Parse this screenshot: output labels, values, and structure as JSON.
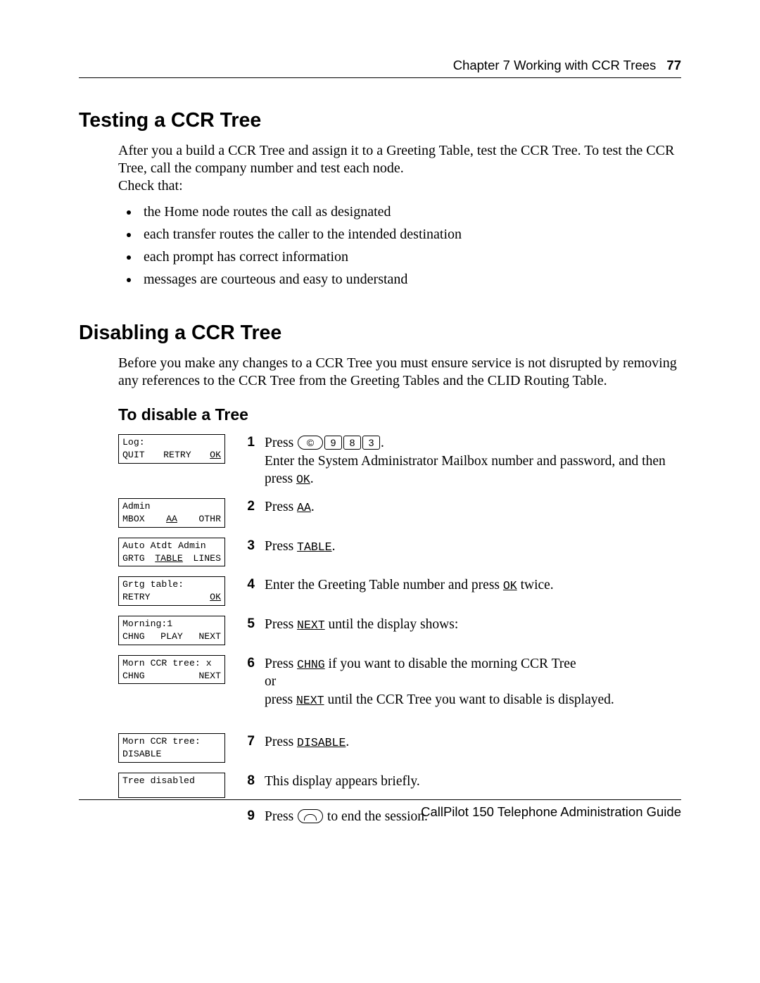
{
  "header": {
    "chapter": "Chapter 7  Working with CCR Trees",
    "page": "77"
  },
  "sec1": {
    "title": "Testing a CCR Tree",
    "p1": "After you a build a CCR Tree and assign it to a Greeting Table, test the CCR Tree. To test the CCR Tree, call the company number and test each node.",
    "check": "Check that:",
    "b1": "the Home node routes the call as designated",
    "b2": "each transfer routes the caller to the intended destination",
    "b3": "each prompt has correct information",
    "b4": "messages are courteous and easy to understand"
  },
  "sec2": {
    "title": "Disabling a CCR Tree",
    "p1": "Before you make any changes to a CCR Tree you must ensure service is not disrupted by removing any references to the CCR Tree from the Greeting Tables and the CLID Routing Table."
  },
  "sub": {
    "title": "To disable a Tree"
  },
  "lcd": {
    "s1l1": "Log:",
    "s1a": "QUIT",
    "s1b": "RETRY",
    "s1c": "OK",
    "s2l1": "Admin",
    "s2a": "MBOX",
    "s2b": "AA",
    "s2c": "OTHR",
    "s3l1": "Auto Atdt Admin",
    "s3a": "GRTG",
    "s3b": "TABLE",
    "s3c": "LINES",
    "s4l1": "Grtg table:",
    "s4a": "RETRY",
    "s4c": "OK",
    "s5l1": "Morning:1",
    "s5a": "CHNG",
    "s5b": "PLAY",
    "s5c": "NEXT",
    "s6l1": "Morn CCR tree: x",
    "s6a": "CHNG",
    "s6c": "NEXT",
    "s7l1": "Morn CCR tree:",
    "s7a": "DISABLE",
    "s8l1": "Tree disabled"
  },
  "steps": {
    "n1": "1",
    "n2": "2",
    "n3": "3",
    "n4": "4",
    "n5": "5",
    "n6": "6",
    "n7": "7",
    "n8": "8",
    "n9": "9",
    "i1a": "Press ",
    "i1k1": "©",
    "i1k2": "9",
    "i1k3": "8",
    "i1k4": "3",
    "i1b": ".",
    "i1c": "Enter the System Administrator Mailbox number and password, and then press ",
    "i1ok": "OK",
    "i1d": ".",
    "i2a": "Press ",
    "i2b": "AA",
    "i2c": ".",
    "i3a": "Press ",
    "i3b": "TABLE",
    "i3c": ".",
    "i4a": "Enter the Greeting Table number and press ",
    "i4b": "OK",
    "i4c": " twice.",
    "i5a": "Press ",
    "i5b": "NEXT",
    "i5c": " until the display shows:",
    "i6a": "Press ",
    "i6b": "CHNG",
    "i6c": " if you want to disable the morning CCR Tree",
    "i6d": "or",
    "i6e": "press ",
    "i6f": "NEXT",
    "i6g": " until the CCR Tree you want to disable is displayed.",
    "i7a": "Press ",
    "i7b": "DISABLE",
    "i7c": ".",
    "i8a": "This display appears briefly.",
    "i9a": "Press ",
    "i9b": " to end the session."
  },
  "footer": "CallPilot 150 Telephone Administration Guide"
}
